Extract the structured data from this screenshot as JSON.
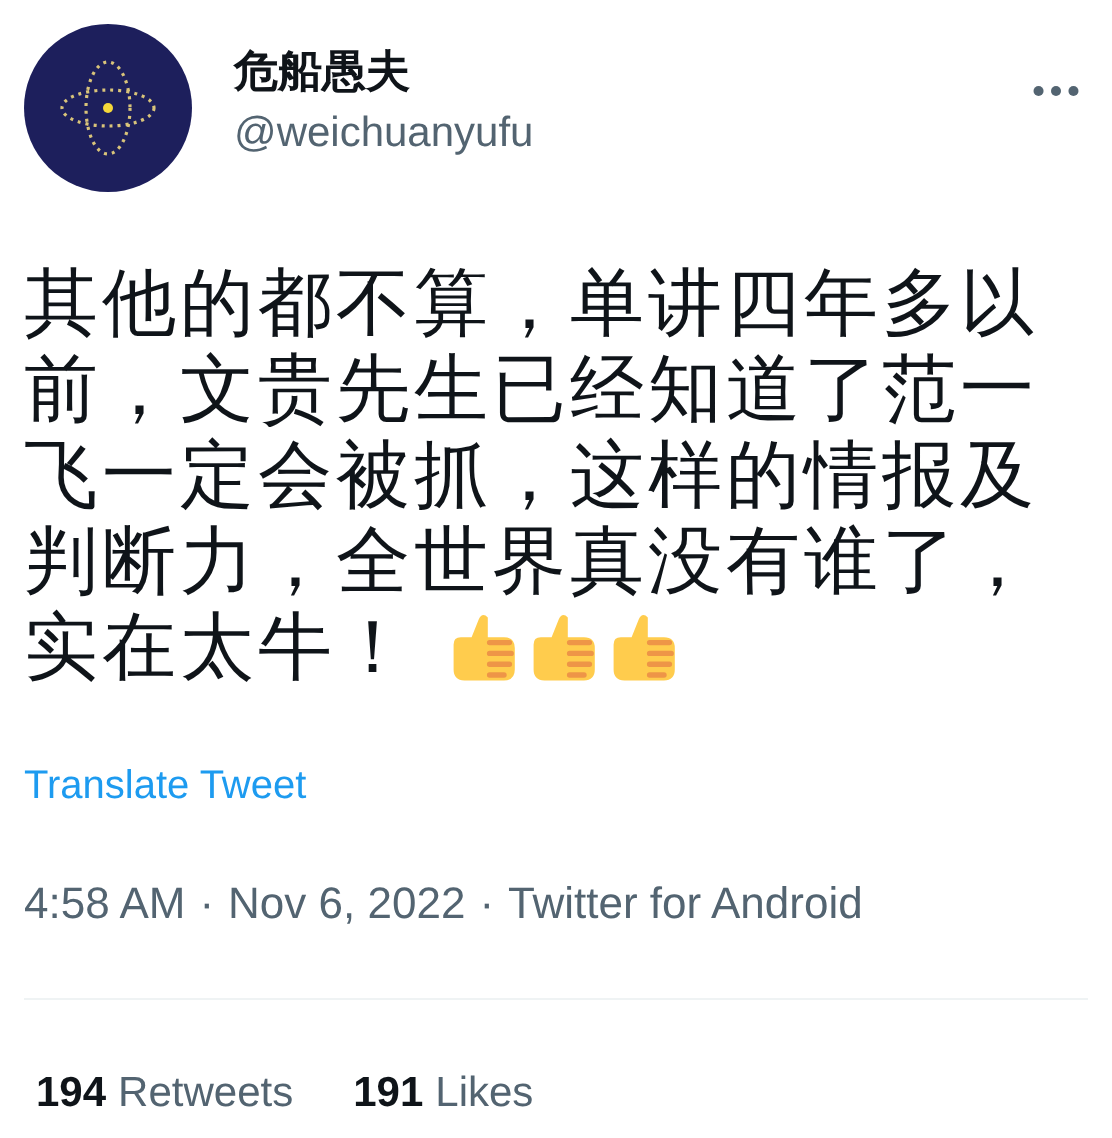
{
  "author": {
    "name": "危船愚夫",
    "handle": "@weichuanyufu"
  },
  "tweet": {
    "lines": [
      "其他的都不算，单讲四年多以",
      "前，文贵先生已经知道了范一",
      "飞一定会被抓，这样的情报及",
      "判断力，全世界真没有谁了，",
      "实在太牛！"
    ],
    "emojis": [
      {
        "kind": "thumbs-up"
      },
      {
        "kind": "thumbs-up"
      },
      {
        "kind": "thumbs-up"
      }
    ]
  },
  "translate_link": "Translate Tweet",
  "meta": {
    "time": "4:58 AM",
    "separator": "·",
    "date": "Nov 6, 2022",
    "source": "Twitter for Android"
  },
  "stats": [
    {
      "count": "194",
      "label": "Retweets"
    },
    {
      "count": "191",
      "label": "Likes"
    }
  ]
}
